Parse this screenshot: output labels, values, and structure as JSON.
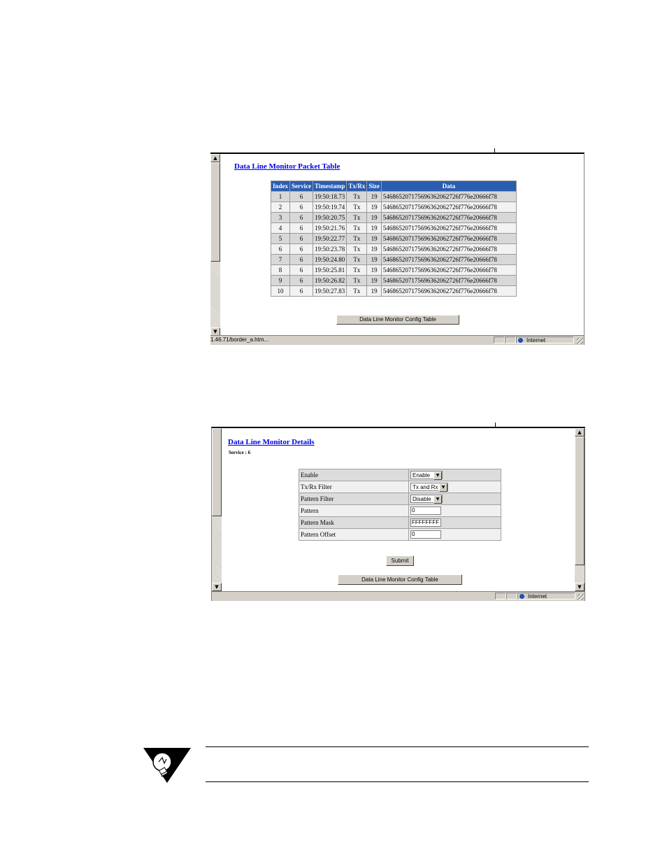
{
  "packet_window": {
    "title": "Data Line Monitor Packet Table",
    "columns": [
      "Index",
      "Service",
      "Timestamp",
      "Tx/Rx",
      "Size",
      "Data"
    ],
    "rows": [
      [
        "1",
        "6",
        "19:50:18.73",
        "Tx",
        "19",
        "546865207175696362062726f776e20666f78"
      ],
      [
        "2",
        "6",
        "19:50:19.74",
        "Tx",
        "19",
        "546865207175696362062726f776e20666f78"
      ],
      [
        "3",
        "6",
        "19:50:20.75",
        "Tx",
        "19",
        "546865207175696362062726f776e20666f78"
      ],
      [
        "4",
        "6",
        "19:50:21.76",
        "Tx",
        "19",
        "546865207175696362062726f776e20666f78"
      ],
      [
        "5",
        "6",
        "19:50:22.77",
        "Tx",
        "19",
        "546865207175696362062726f776e20666f78"
      ],
      [
        "6",
        "6",
        "19:50:23.78",
        "Tx",
        "19",
        "546865207175696362062726f776e20666f78"
      ],
      [
        "7",
        "6",
        "19:50:24.80",
        "Tx",
        "19",
        "546865207175696362062726f776e20666f78"
      ],
      [
        "8",
        "6",
        "19:50:25.81",
        "Tx",
        "19",
        "546865207175696362062726f776e20666f78"
      ],
      [
        "9",
        "6",
        "19:50:26.82",
        "Tx",
        "19",
        "546865207175696362062726f776e20666f78"
      ],
      [
        "10",
        "6",
        "19:50:27.83",
        "Tx",
        "19",
        "546865207175696362062726f776e20666f78"
      ]
    ],
    "config_button": "Data Line Monitor Config Table",
    "status_url": "1.46.71/border_a.htm...",
    "status_zone": "Internet"
  },
  "details_window": {
    "title": "Data Line Monitor Details",
    "service": "Service : 6",
    "fields": {
      "enable": {
        "label": "Enable",
        "value": "Enable"
      },
      "txrx": {
        "label": "Tx/Rx Filter",
        "value": "Tx and Rx"
      },
      "pattern_filter": {
        "label": "Pattern Filter",
        "value": "Disable"
      },
      "pattern": {
        "label": "Pattern",
        "value": "0"
      },
      "pattern_mask": {
        "label": "Pattern Mask",
        "value": "FFFFFFFF"
      },
      "pattern_offset": {
        "label": "Pattern Offset",
        "value": "0"
      }
    },
    "submit_button": "Submit",
    "config_button": "Data Line Monitor Config Table",
    "status_zone": "Internet"
  },
  "colors": {
    "header_blue": "#2a5db0",
    "link_blue": "#0000ee",
    "chrome_gray": "#d4d0c8"
  },
  "icons": {
    "note": "lightbulb-icon",
    "globe": "globe-icon"
  }
}
